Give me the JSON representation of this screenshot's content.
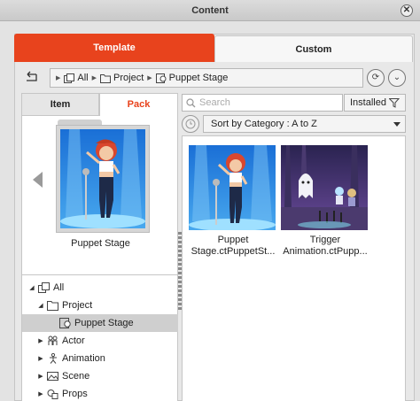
{
  "window": {
    "title": "Content"
  },
  "tabs": {
    "template": "Template",
    "custom": "Custom"
  },
  "breadcrumb": {
    "items": [
      "All",
      "Project",
      "Puppet Stage"
    ]
  },
  "left_panel": {
    "tabs": {
      "item": "Item",
      "pack": "Pack"
    },
    "preview_caption": "Puppet Stage"
  },
  "tree": {
    "all": "All",
    "project": "Project",
    "puppet_stage": "Puppet Stage",
    "actor": "Actor",
    "animation": "Animation",
    "scene": "Scene",
    "props": "Props"
  },
  "search": {
    "placeholder": "Search",
    "value": ""
  },
  "filter": {
    "installed_label": "Installed"
  },
  "sort": {
    "selected": "Sort by Category : A to Z"
  },
  "cards": [
    {
      "line1": "Puppet",
      "line2": "Stage.ctPuppetSt..."
    },
    {
      "line1": "Trigger",
      "line2": "Animation.ctPupp..."
    }
  ],
  "colors": {
    "accent": "#e8431d",
    "selection": "#cfcfcf"
  },
  "icons": [
    "close-icon",
    "back-arrow-icon",
    "folder-icon",
    "puppet-icon",
    "refresh-icon",
    "chevron-down-icon",
    "search-icon",
    "filter-icon",
    "clock-icon",
    "actor-icon",
    "animation-icon",
    "scene-icon",
    "props-icon"
  ]
}
